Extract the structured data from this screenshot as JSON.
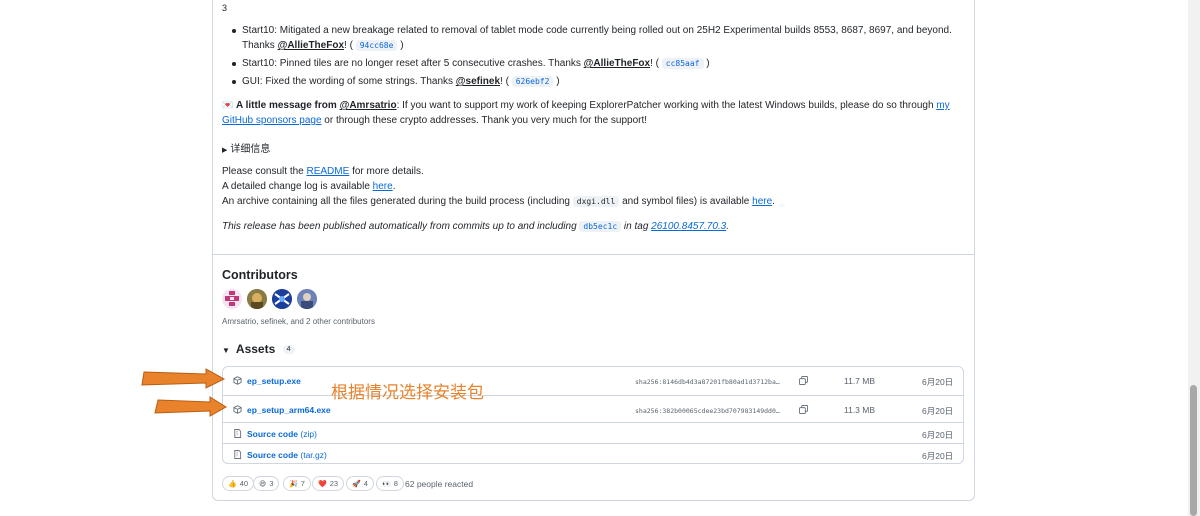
{
  "top_number": "3",
  "bullets": [
    {
      "line1": "Start10: Mitigated a new breakage related to removal of tablet mode code currently being rolled out on 25H2 Experimental builds 8553, 8687, 8697, and beyond.",
      "thanks": "Thanks ",
      "mention": "@AllieTheFox",
      "after_mention": "! (",
      "sha": "94cc68e",
      "close": ")"
    },
    {
      "text": "Start10: Pinned tiles are no longer reset after 5 consecutive crashes. Thanks ",
      "mention": "@AllieTheFox",
      "after_mention": "! (",
      "sha": "cc85aaf",
      "close": ")"
    },
    {
      "text": "GUI: Fixed the wording of some strings. Thanks ",
      "mention": "@sefinek",
      "after_mention": "! (",
      "sha": "626ebf2",
      "close": ")"
    }
  ],
  "message": {
    "emoji": "💌",
    "bold": "A little message from ",
    "mention": "@Amrsatrio",
    "text1": ": If you want to support my work of keeping ExplorerPatcher working with the latest Windows builds, please do so through ",
    "link1": "my",
    "link2": "GitHub sponsors page",
    "text2": " or through these crypto addresses. Thank you very much for the support!"
  },
  "details_toggle": "详细信息",
  "readme": {
    "before": "Please consult the ",
    "link": "README",
    "after": " for more details."
  },
  "changelog": {
    "before": "A detailed change log is available ",
    "link": "here",
    "after": "."
  },
  "archive": {
    "before": "An archive containing all the files generated during the build process (including ",
    "code": "dxgi.dll",
    "middle": " and symbol files) is available ",
    "link": "here",
    "after": "."
  },
  "auto_note": {
    "before": "This release has been published automatically from commits up to and including ",
    "sha": "db5ec1c",
    "middle": " in tag ",
    "tag": "26100.8457.70.3",
    "after": "."
  },
  "contributors": {
    "heading": "Contributors",
    "summary": "Amrsatrio, sefinek, and 2 other contributors"
  },
  "assets": {
    "heading": "Assets",
    "count": "4",
    "items": [
      {
        "name": "ep_setup.exe",
        "sha": "sha256:8146db4d3a87201fb80ad1d3712ba…",
        "size": "11.7 MB",
        "date": "6月20日"
      },
      {
        "name": "ep_setup_arm64.exe",
        "sha": "sha256:382b00065cdee23bd707983149dd0…",
        "size": "11.3 MB",
        "date": "6月20日"
      },
      {
        "name": "Source code",
        "suffix": " (zip)",
        "date": "6月20日"
      },
      {
        "name": "Source code",
        "suffix": " (tar.gz)",
        "date": "6月20日"
      }
    ]
  },
  "reactions": [
    {
      "emoji": "👍",
      "count": "40"
    },
    {
      "emoji": "😄",
      "count": "3"
    },
    {
      "emoji": "🎉",
      "count": "7"
    },
    {
      "emoji": "❤️",
      "count": "23"
    },
    {
      "emoji": "🚀",
      "count": "4"
    },
    {
      "emoji": "👀",
      "count": "8"
    }
  ],
  "reacted_summary": "62 people reacted",
  "annotation": "根据情况选择安装包",
  "colors": {
    "link": "#0969da",
    "annotation": "#e8822b",
    "border": "#d0d7de"
  }
}
